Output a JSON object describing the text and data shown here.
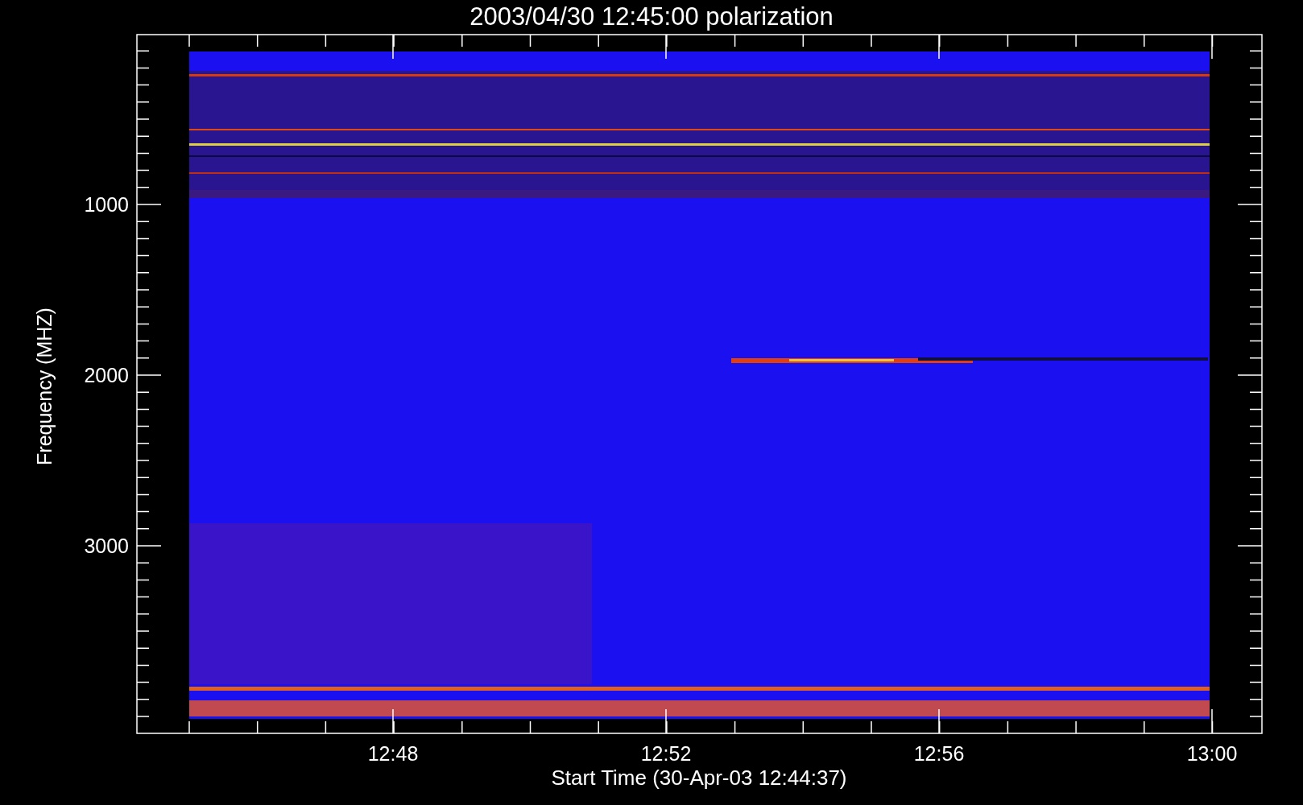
{
  "title": "2003/04/30 12:45:00 polarization",
  "y_axis": {
    "label": "Frequency (MHZ)",
    "ticks": [
      "1000",
      "2000",
      "3000"
    ]
  },
  "x_axis": {
    "label": "Start Time (30-Apr-03 12:44:37)",
    "ticks": [
      "12:48",
      "12:52",
      "12:56",
      "13:00"
    ]
  }
}
